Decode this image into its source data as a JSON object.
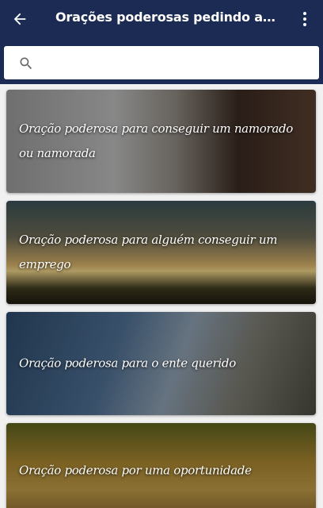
{
  "appbar": {
    "title": "Orações poderosas pedindo a luz do S...",
    "back_icon": "arrow-left-icon",
    "menu_icon": "more-vertical-icon",
    "color": "#1c2b53"
  },
  "search": {
    "icon": "search-icon",
    "value": "",
    "placeholder": ""
  },
  "cards": [
    {
      "title": "Oração poderosa para conseguir um namorado ou namorada"
    },
    {
      "title": "Oração poderosa para alguém conseguir um emprego"
    },
    {
      "title": "Oração poderosa para o ente querido"
    },
    {
      "title": "Oração poderosa por uma oportunidade"
    }
  ]
}
